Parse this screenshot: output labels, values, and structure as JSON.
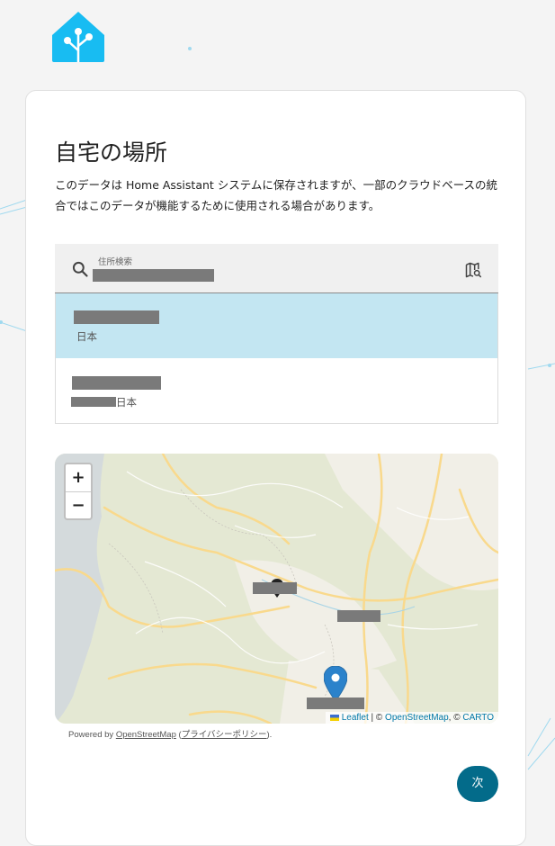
{
  "page": {
    "title": "自宅の場所",
    "description": "このデータは Home Assistant システムに保存されますが、一部のクラウドベースの統合ではこのデータが機能するために使用される場合があります。"
  },
  "search": {
    "label": "住所検索",
    "icons": [
      "search-icon",
      "map-search-icon"
    ]
  },
  "results": [
    {
      "secondary": "日本",
      "selected": true
    },
    {
      "secondary": "日本",
      "selected": false
    }
  ],
  "map": {
    "zoom_in": "+",
    "zoom_out": "−",
    "attribution": {
      "leaflet": "Leaflet",
      "sep1": " | © ",
      "osm": "OpenStreetMap",
      "sep2": ", © ",
      "carto": "CARTO"
    }
  },
  "powered": {
    "prefix": "Powered by ",
    "osm": "OpenStreetMap",
    "open_paren": " (",
    "privacy": "プライバシーポリシー",
    "close": ")."
  },
  "actions": {
    "next_label": "次"
  },
  "colors": {
    "primary": "#036b8a",
    "logo": "#18bcf2",
    "selected_row": "#c3e6f2",
    "marker": "#2b82cb"
  }
}
